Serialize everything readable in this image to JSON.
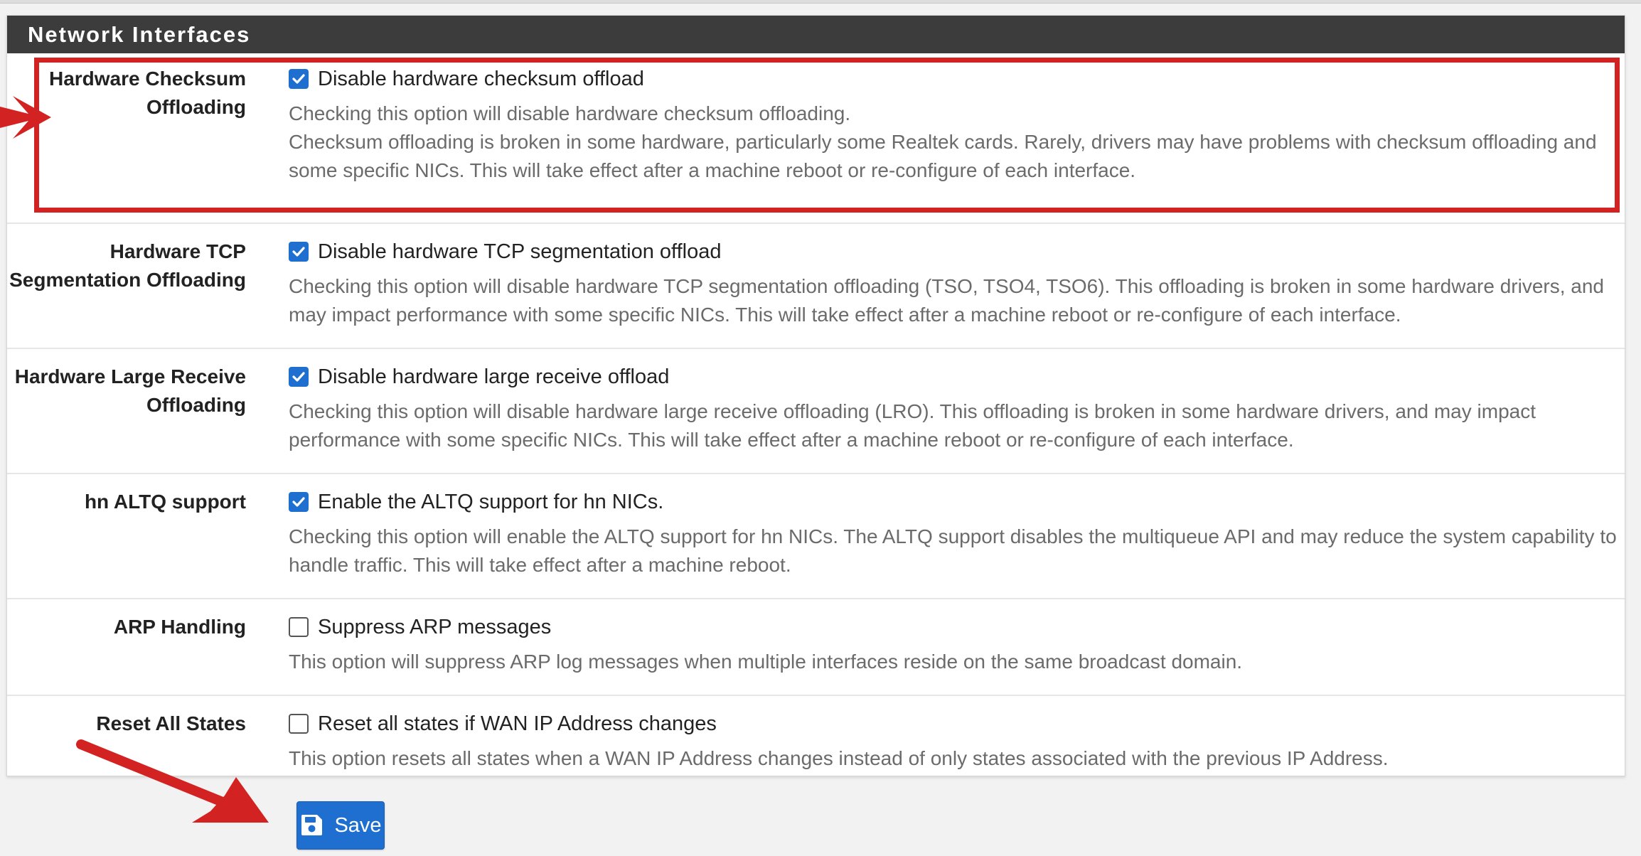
{
  "panel": {
    "title": "Network Interfaces",
    "rows": [
      {
        "label_lines": [
          "Hardware Checksum",
          "Offloading"
        ],
        "checkbox_label": "Disable hardware checksum offload",
        "checked": true,
        "help_lines": [
          "Checking this option will disable hardware checksum offloading.",
          "Checksum offloading is broken in some hardware, particularly some Realtek cards. Rarely, drivers may have problems with checksum offloading and",
          "some specific NICs. This will take effect after a machine reboot or re-configure of each interface."
        ]
      },
      {
        "label_lines": [
          "Hardware TCP",
          "Segmentation Offloading"
        ],
        "checkbox_label": "Disable hardware TCP segmentation offload",
        "checked": true,
        "help_lines": [
          "Checking this option will disable hardware TCP segmentation offloading (TSO, TSO4, TSO6). This offloading is broken in some hardware drivers, and",
          "may impact performance with some specific NICs. This will take effect after a machine reboot or re-configure of each interface."
        ]
      },
      {
        "label_lines": [
          "Hardware Large Receive",
          "Offloading"
        ],
        "checkbox_label": "Disable hardware large receive offload",
        "checked": true,
        "help_lines": [
          "Checking this option will disable hardware large receive offloading (LRO). This offloading is broken in some hardware drivers, and may impact",
          "performance with some specific NICs. This will take effect after a machine reboot or re-configure of each interface."
        ]
      },
      {
        "label_lines": [
          "hn ALTQ support"
        ],
        "checkbox_label": "Enable the ALTQ support for hn NICs.",
        "checked": true,
        "help_lines": [
          "Checking this option will enable the ALTQ support for hn NICs. The ALTQ support disables the multiqueue API and may reduce the system capability to",
          "handle traffic. This will take effect after a machine reboot."
        ]
      },
      {
        "label_lines": [
          "ARP Handling"
        ],
        "checkbox_label": "Suppress ARP messages",
        "checked": false,
        "help_lines": [
          "This option will suppress ARP log messages when multiple interfaces reside on the same broadcast domain."
        ]
      },
      {
        "label_lines": [
          "Reset All States"
        ],
        "checkbox_label": "Reset all states if WAN IP Address changes",
        "checked": false,
        "help_lines": [
          "This option resets all states when a WAN IP Address changes instead of only states associated with the previous IP Address."
        ]
      }
    ]
  },
  "save_button": {
    "label": "Save",
    "icon": "floppy-disk-icon"
  },
  "annotations": {
    "highlight_color": "#d32222",
    "arrow_color": "#d32222"
  },
  "colors": {
    "accent": "#1f6fd1",
    "heading_bg": "#3c3c3c"
  }
}
